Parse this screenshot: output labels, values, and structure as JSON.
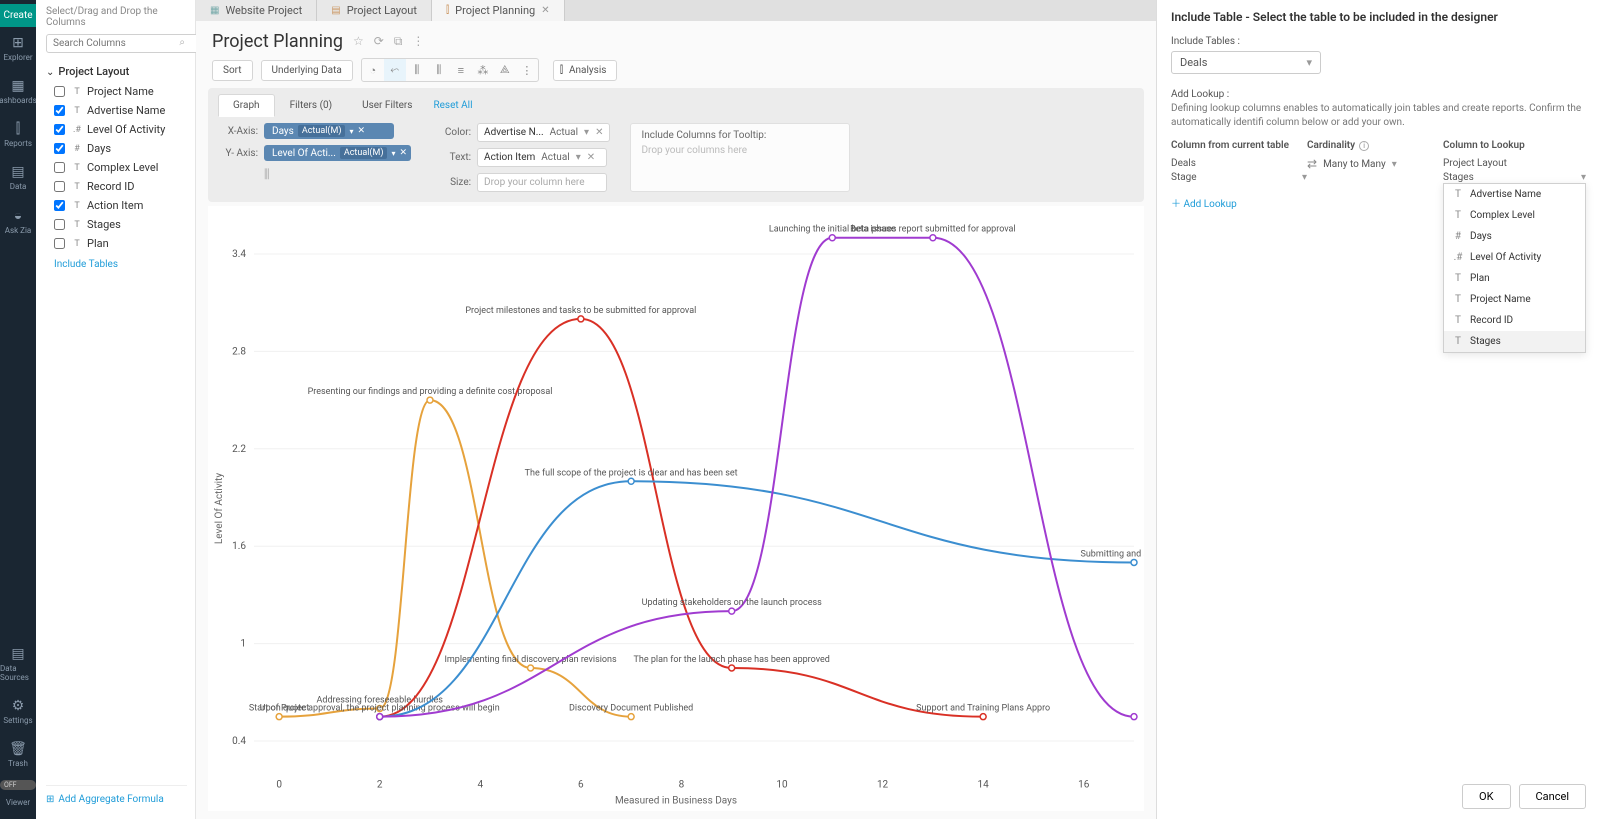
{
  "rail": {
    "create": "Create",
    "items": [
      {
        "icon": "⊞",
        "label": "Explorer"
      },
      {
        "icon": "▦",
        "label": "ashboards"
      },
      {
        "icon": "⫿",
        "label": "Reports"
      },
      {
        "icon": "▤",
        "label": "Data"
      },
      {
        "icon": "◒",
        "label": "Ask Zia"
      }
    ],
    "bottom": [
      {
        "icon": "▤",
        "label": "Data Sources"
      },
      {
        "icon": "⚙",
        "label": "Settings"
      },
      {
        "icon": "🗑",
        "label": "Trash"
      }
    ],
    "viewer_toggle": "OFF",
    "viewer": "Viewer"
  },
  "columns_panel": {
    "hint": "Select/Drag and Drop the Columns",
    "search_placeholder": "Search Columns",
    "group": "Project Layout",
    "items": [
      {
        "checked": false,
        "type": "T",
        "name": "Project Name"
      },
      {
        "checked": true,
        "type": "T",
        "name": "Advertise Name"
      },
      {
        "checked": true,
        "type": ".#",
        "name": "Level Of Activity"
      },
      {
        "checked": true,
        "type": "#",
        "name": "Days"
      },
      {
        "checked": false,
        "type": "T",
        "name": "Complex Level"
      },
      {
        "checked": false,
        "type": "T",
        "name": "Record ID"
      },
      {
        "checked": true,
        "type": "T",
        "name": "Action Item"
      },
      {
        "checked": false,
        "type": "T",
        "name": "Stages"
      },
      {
        "checked": false,
        "type": "T",
        "name": "Plan"
      }
    ],
    "include_tables": "Include Tables",
    "add_aggregate": "Add Aggregate Formula"
  },
  "tabs": [
    {
      "icon": "▦",
      "label": "Website Project",
      "active": false,
      "icon_color": "#7aa"
    },
    {
      "icon": "▤",
      "label": "Project Layout",
      "active": false,
      "icon_color": "#c96"
    },
    {
      "icon": "⫿",
      "label": "Project Planning",
      "active": true,
      "icon_color": "#c96",
      "close": true
    }
  ],
  "page_title": "Project Planning",
  "toolbar": {
    "sort": "Sort",
    "underlying": "Underlying Data",
    "analysis": "Analysis"
  },
  "config": {
    "tabs": [
      "Graph",
      "Filters  (0)",
      "User Filters"
    ],
    "reset": "Reset All",
    "xaxis_label": "X-Axis:",
    "xaxis_value": "Days",
    "xaxis_agg": "Actual(M)",
    "yaxis_label": "Y- Axis:",
    "yaxis_value": "Level Of Acti...",
    "yaxis_agg": "Actual(M)",
    "color_label": "Color:",
    "color_value": "Advertise N...",
    "color_agg": "Actual",
    "text_label": "Text:",
    "text_value": "Action Item",
    "text_agg": "Actual",
    "size_label": "Size:",
    "size_placeholder": "Drop your column here",
    "tooltip_head": "Include Columns for Tooltip:",
    "tooltip_placeholder": "Drop your columns here"
  },
  "chart_data": {
    "type": "line",
    "xlabel": "Measured in Business Days",
    "ylabel": "Level Of Activity",
    "x_ticks": [
      0,
      2,
      4,
      6,
      8,
      10,
      12,
      14,
      16
    ],
    "y_ticks": [
      0.4,
      1,
      1.6,
      2.2,
      2.8,
      3.4
    ],
    "ylim": [
      0.2,
      3.6
    ],
    "xlim": [
      -0.5,
      17
    ],
    "series": [
      {
        "name": "Orange",
        "color": "#e6a23c",
        "points": [
          {
            "x": 0,
            "y": 0.55,
            "label": "Start of Project"
          },
          {
            "x": 2,
            "y": 0.6,
            "label": "Addressing foreseeable hurdles"
          },
          {
            "x": 3,
            "y": 2.5,
            "label": "Presenting our findings and providing a definite cost proposal"
          },
          {
            "x": 5,
            "y": 0.85,
            "label": "Implementing final discovery plan revisions"
          },
          {
            "x": 7,
            "y": 0.55,
            "label": "Discovery Document Published"
          }
        ]
      },
      {
        "name": "Red",
        "color": "#d93025",
        "points": [
          {
            "x": 2,
            "y": 0.55,
            "label": "Upon quote approval, the project planning process will begin"
          },
          {
            "x": 6,
            "y": 3.0,
            "label": "Project milestones and tasks to be submitted for approval"
          },
          {
            "x": 9,
            "y": 0.85,
            "label": "The plan for the launch phase has been approved"
          },
          {
            "x": 14,
            "y": 0.55,
            "label": "Support and Training Plans Appro"
          }
        ]
      },
      {
        "name": "Blue",
        "color": "#3b8ed0",
        "points": [
          {
            "x": 2,
            "y": 0.55
          },
          {
            "x": 7,
            "y": 2.0,
            "label": "The full scope of the project is clear and has been set"
          },
          {
            "x": 17,
            "y": 1.5,
            "label": "Submitting and sharing lau"
          }
        ]
      },
      {
        "name": "Purple",
        "color": "#a03bd0",
        "points": [
          {
            "x": 2,
            "y": 0.55
          },
          {
            "x": 9,
            "y": 1.2,
            "label": "Updating stakeholders on the launch process"
          },
          {
            "x": 11,
            "y": 3.5,
            "label": "Launching the initial beta phase"
          },
          {
            "x": 13,
            "y": 3.5,
            "label": "Beta issues report submitted for approval"
          },
          {
            "x": 17,
            "y": 0.55
          }
        ]
      }
    ]
  },
  "right_panel": {
    "title": "Include Table - Select the table to be included in the designer",
    "include_label": "Include Tables :",
    "include_value": "Deals",
    "lookup_head": "Add Lookup :",
    "lookup_help": "Defining lookup columns enables to automatically join tables and create reports. Confirm the automatically identifi column below or add your own.",
    "col_current": "Column from current table",
    "cardinality": "Cardinality",
    "col_lookup": "Column to Lookup",
    "current_table": "Deals",
    "current_col": "Stage",
    "cardinality_value": "Many to Many",
    "lookup_table": "Project Layout",
    "lookup_col": "Stages",
    "add_lookup": "Add Lookup",
    "dropdown": [
      {
        "type": "T",
        "label": "Advertise Name"
      },
      {
        "type": "T",
        "label": "Complex Level"
      },
      {
        "type": "#",
        "label": "Days"
      },
      {
        "type": ".#",
        "label": "Level Of Activity"
      },
      {
        "type": "T",
        "label": "Plan"
      },
      {
        "type": "T",
        "label": "Project Name"
      },
      {
        "type": "T",
        "label": "Record ID"
      },
      {
        "type": "T",
        "label": "Stages",
        "hl": true
      }
    ],
    "ok": "OK",
    "cancel": "Cancel"
  }
}
